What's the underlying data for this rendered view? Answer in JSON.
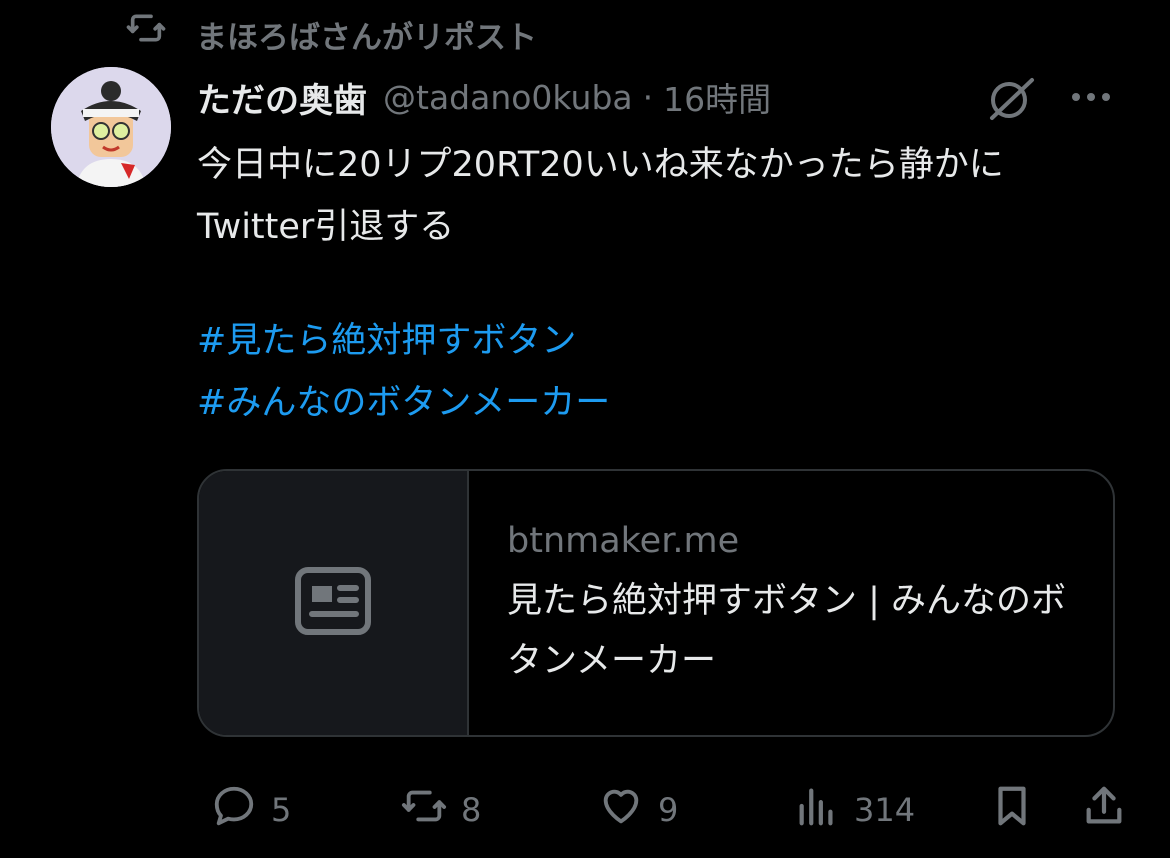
{
  "repost": {
    "label": "まほろばさんがリポスト"
  },
  "tweet": {
    "author_name": "ただの奥歯",
    "handle": "@tadano0kuba",
    "separator": "·",
    "time": "16時間",
    "text": "今日中に20リプ20RT20いいね来なかったら静かにTwitter引退する",
    "hashtags": [
      "#見たら絶対押すボタン",
      "#みんなのボタンメーカー"
    ]
  },
  "card": {
    "domain": "btnmaker.me",
    "title": "見たら絶対押すボタン | みんなのボタンメーカー"
  },
  "actions": {
    "replies": "5",
    "reposts": "8",
    "likes": "9",
    "views": "314"
  },
  "icons": {
    "repost": "repost-icon",
    "grok": "grok-icon",
    "more": "more-icon",
    "reply": "reply-icon",
    "like": "heart-icon",
    "views": "views-icon",
    "bookmark": "bookmark-icon",
    "share": "share-icon",
    "card_placeholder": "article-icon"
  },
  "colors": {
    "link": "#1d9bf0",
    "muted": "#71767b",
    "text": "#e7e9ea",
    "background": "#000000"
  }
}
